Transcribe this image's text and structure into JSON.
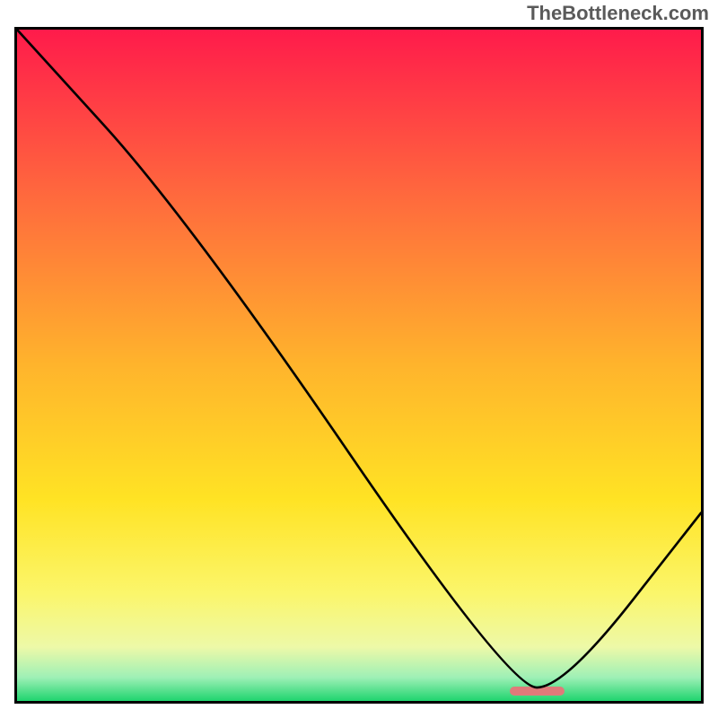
{
  "watermark": "TheBottleneck.com",
  "chart_data": {
    "type": "line",
    "title": "",
    "xlabel": "",
    "ylabel": "",
    "xlim": [
      0,
      100
    ],
    "ylim": [
      0,
      100
    ],
    "grid": false,
    "series": [
      {
        "name": "curve",
        "x": [
          0,
          25,
          72,
          80,
          100
        ],
        "values": [
          100,
          72,
          2,
          2,
          28
        ]
      }
    ],
    "marker": {
      "x_start": 72,
      "x_end": 80,
      "y": 1.5
    },
    "gradient_stops": [
      {
        "pos": 0.0,
        "color": "#ff1b4b"
      },
      {
        "pos": 0.25,
        "color": "#ff6a3d"
      },
      {
        "pos": 0.5,
        "color": "#ffb42c"
      },
      {
        "pos": 0.7,
        "color": "#ffe324"
      },
      {
        "pos": 0.84,
        "color": "#fbf66b"
      },
      {
        "pos": 0.92,
        "color": "#edf9a8"
      },
      {
        "pos": 0.965,
        "color": "#9ef0b6"
      },
      {
        "pos": 1.0,
        "color": "#1fd46e"
      }
    ]
  }
}
